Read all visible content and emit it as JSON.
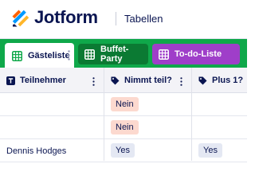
{
  "header": {
    "brand": "Jotform",
    "section_title": "Tabellen"
  },
  "tabs": [
    {
      "label": "Gästeliste",
      "active": true
    },
    {
      "label": "Buffet-Party",
      "active": false
    },
    {
      "label": "To-do-Liste",
      "active": false
    }
  ],
  "columns": [
    {
      "label": "Teilnehmer",
      "icon": "text-type-icon"
    },
    {
      "label": "Nimmt teil?",
      "icon": "tag-icon"
    },
    {
      "label": "Plus 1?",
      "icon": "tag-icon"
    }
  ],
  "rows": [
    {
      "teilnehmer": "",
      "nimmt_teil": "Nein",
      "plus1": ""
    },
    {
      "teilnehmer": "",
      "nimmt_teil": "Nein",
      "plus1": ""
    },
    {
      "teilnehmer": "Dennis Hodges",
      "nimmt_teil": "Yes",
      "plus1": "Yes"
    }
  ],
  "colors": {
    "tabbar": "#0fa84a",
    "buffet_tab": "#0b7a33",
    "todo_tab": "#9f3ec9",
    "badge_nein": "#fcd9cf",
    "badge_yes": "#e4e8f3",
    "text": "#0a1551"
  }
}
